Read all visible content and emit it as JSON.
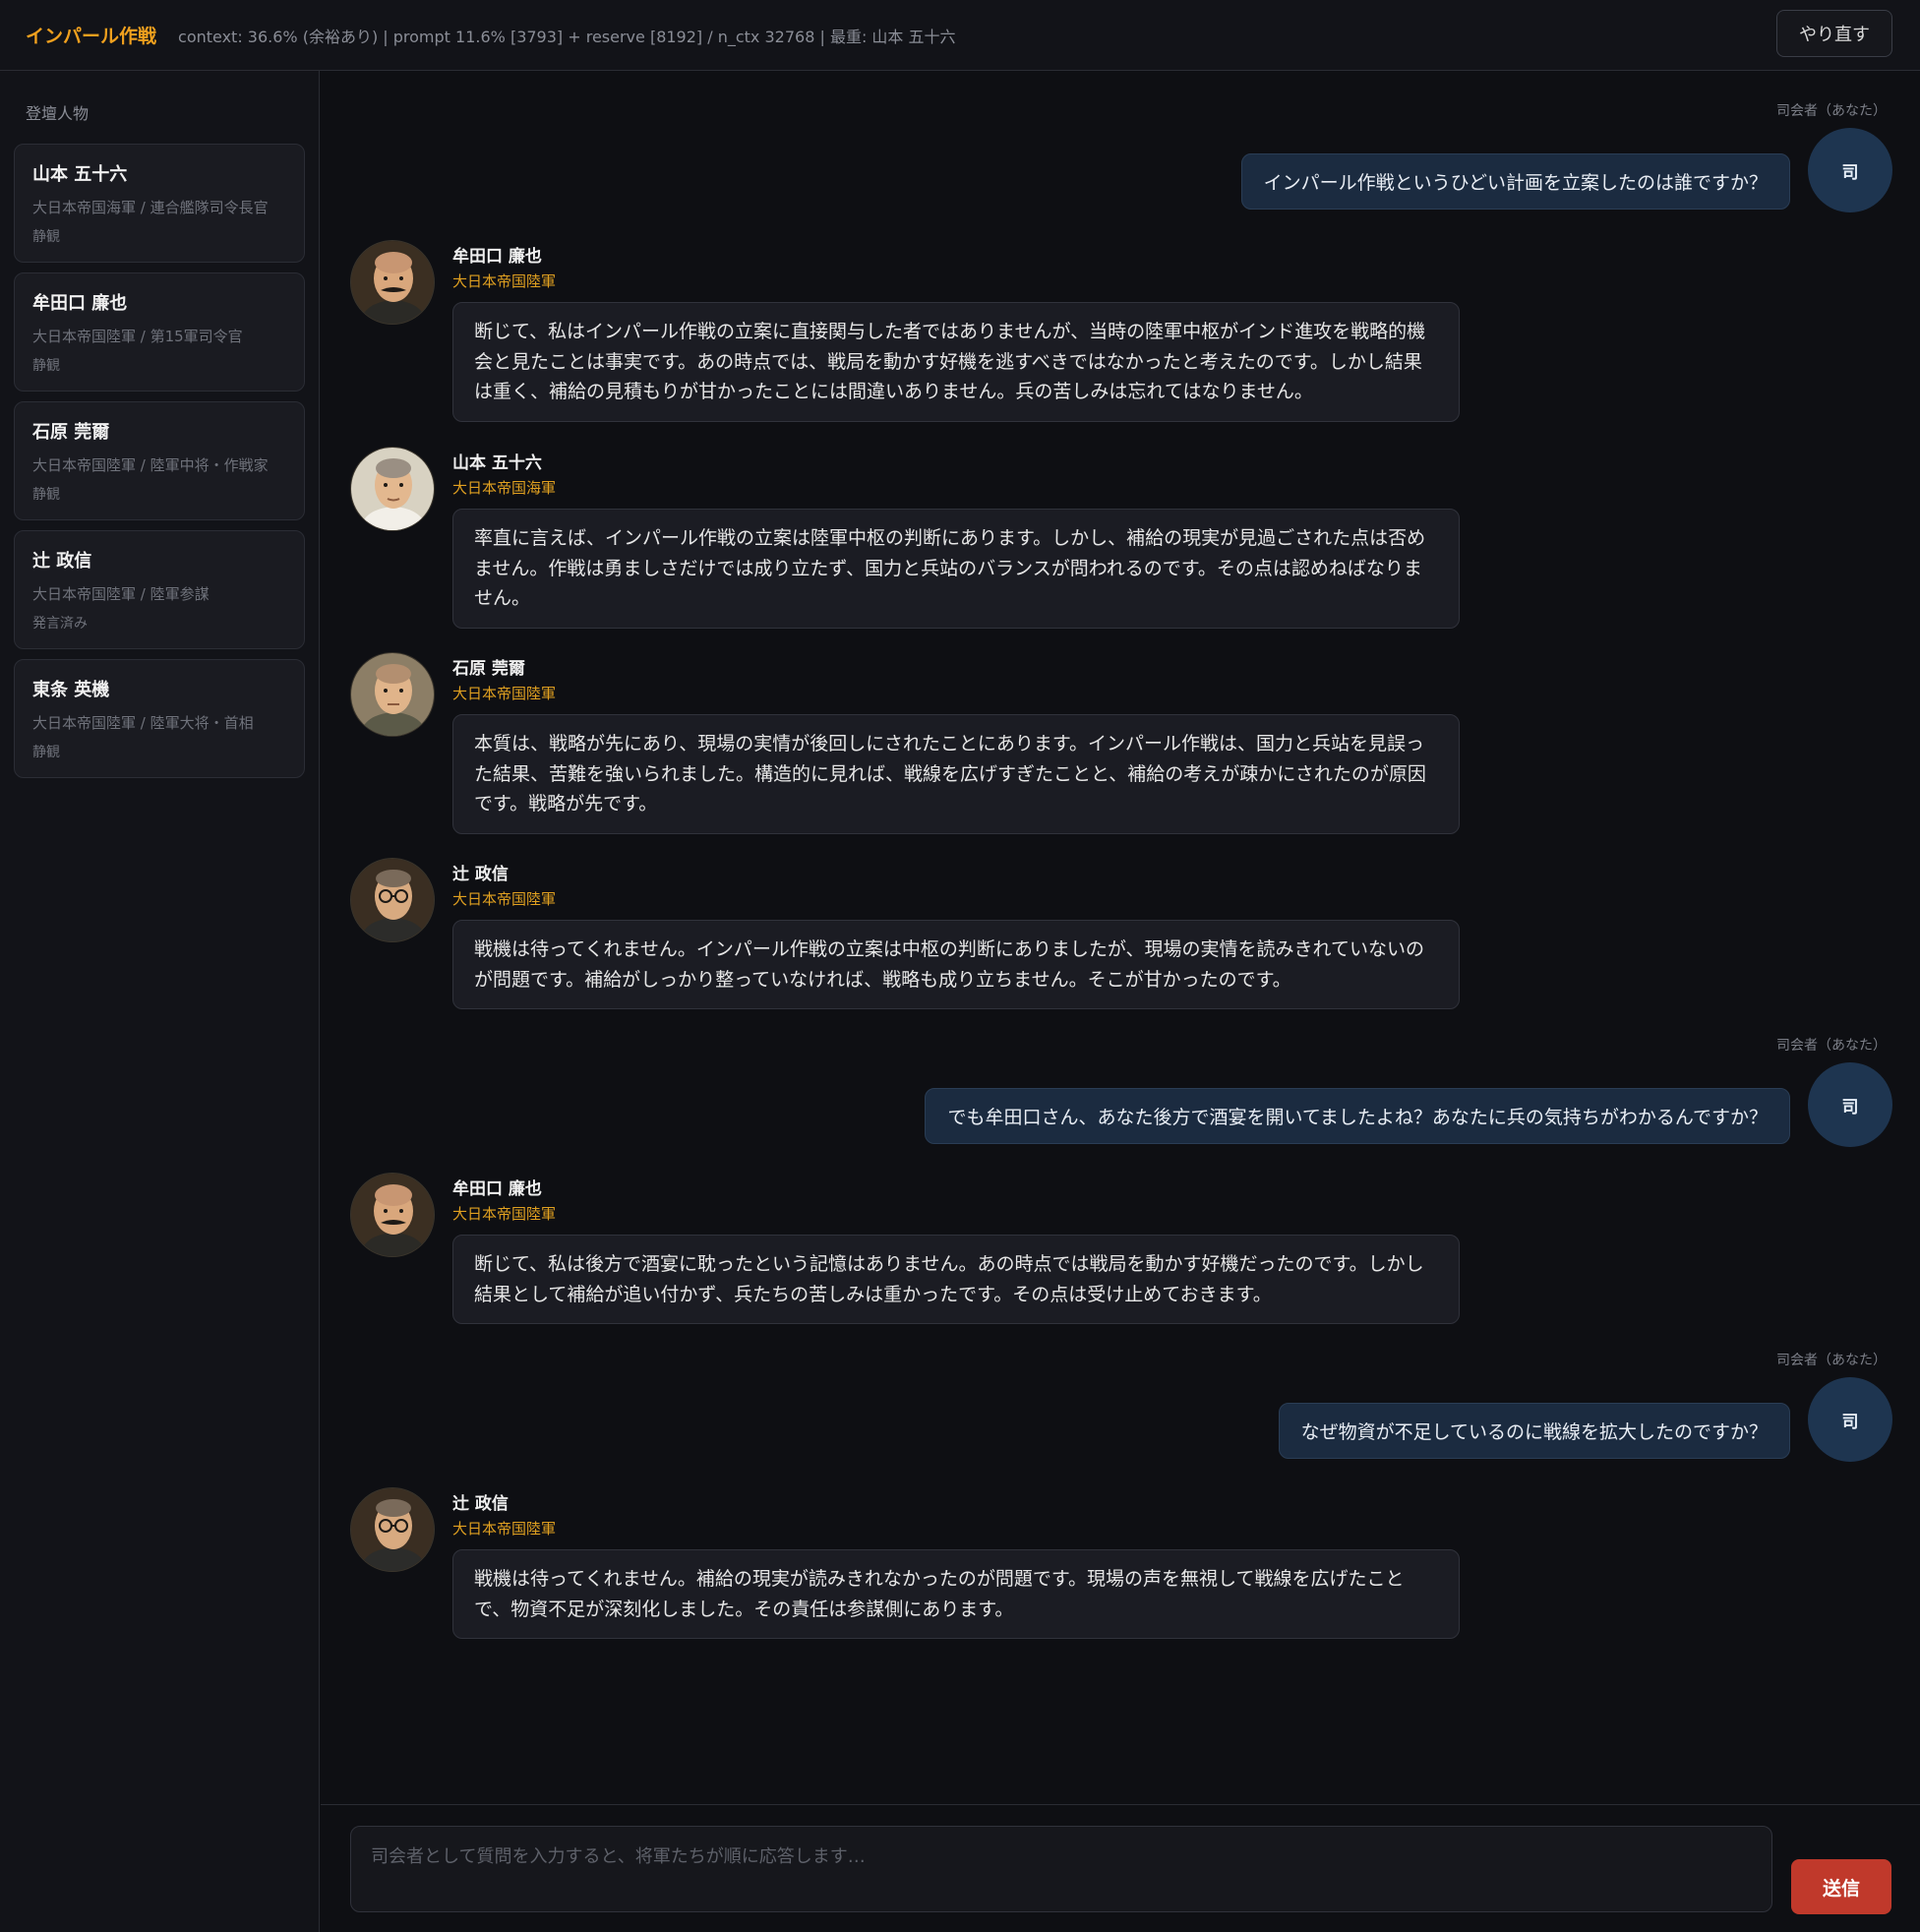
{
  "header": {
    "title": "インパール作戦",
    "context_info": "context: 36.6% (余裕あり) | prompt 11.6% [3793] + reserve [8192] / n_ctx 32768 | 最重: 山本 五十六",
    "redo_label": "やり直す"
  },
  "sidebar": {
    "title": "登壇人物",
    "characters": [
      {
        "name": "山本 五十六",
        "role": "大日本帝国海軍 / 連合艦隊司令長官",
        "status": "静観"
      },
      {
        "name": "牟田口 廉也",
        "role": "大日本帝国陸軍 / 第15軍司令官",
        "status": "静観"
      },
      {
        "name": "石原 莞爾",
        "role": "大日本帝国陸軍 / 陸軍中将・作戦家",
        "status": "静観"
      },
      {
        "name": "辻 政信",
        "role": "大日本帝国陸軍 / 陸軍参謀",
        "status": "発言済み"
      },
      {
        "name": "東条 英機",
        "role": "大日本帝国陸軍 / 陸軍大将・首相",
        "status": "静観"
      }
    ]
  },
  "messages": [
    {
      "role": "user",
      "label": "司会者（あなた）",
      "avatar": "司",
      "text": "インパール作戦というひどい計画を立案したのは誰ですか？"
    },
    {
      "role": "bot",
      "name": "牟田口 廉也",
      "affiliation": "大日本帝国陸軍",
      "avatar_icon": "general-mustache-portrait",
      "text": "断じて、私はインパール作戦の立案に直接関与した者ではありませんが、当時の陸軍中枢がインド進攻を戦略的機会と見たことは事実です。あの時点では、戦局を動かす好機を逃すべきではなかったと考えたのです。しかし結果は重く、補給の見積もりが甘かったことには間違いありません。兵の苦しみは忘れてはなりません。"
    },
    {
      "role": "bot",
      "name": "山本 五十六",
      "affiliation": "大日本帝国海軍",
      "avatar_icon": "admiral-portrait",
      "text": "率直に言えば、インパール作戦の立案は陸軍中枢の判断にあります。しかし、補給の現実が見過ごされた点は否めません。作戦は勇ましさだけでは成り立たず、国力と兵站のバランスが問われるのです。その点は認めねばなりません。"
    },
    {
      "role": "bot",
      "name": "石原 莞爾",
      "affiliation": "大日本帝国陸軍",
      "avatar_icon": "general-portrait",
      "text": "本質は、戦略が先にあり、現場の実情が後回しにされたことにあります。インパール作戦は、国力と兵站を見誤った結果、苦難を強いられました。構造的に見れば、戦線を広げすぎたことと、補給の考えが疎かにされたのが原因です。戦略が先です。"
    },
    {
      "role": "bot",
      "name": "辻 政信",
      "affiliation": "大日本帝国陸軍",
      "avatar_icon": "officer-glasses-portrait",
      "text": "戦機は待ってくれません。インパール作戦の立案は中枢の判断にありましたが、現場の実情を読みきれていないのが問題です。補給がしっかり整っていなければ、戦略も成り立ちません。そこが甘かったのです。"
    },
    {
      "role": "user",
      "label": "司会者（あなた）",
      "avatar": "司",
      "text": "でも牟田口さん、あなた後方で酒宴を開いてましたよね？あなたに兵の気持ちがわかるんですか？"
    },
    {
      "role": "bot",
      "name": "牟田口 廉也",
      "affiliation": "大日本帝国陸軍",
      "avatar_icon": "general-mustache-portrait",
      "text": "断じて、私は後方で酒宴に耽ったという記憶はありません。あの時点では戦局を動かす好機だったのです。しかし結果として補給が追い付かず、兵たちの苦しみは重かったです。その点は受け止めておきます。"
    },
    {
      "role": "user",
      "label": "司会者（あなた）",
      "avatar": "司",
      "text": "なぜ物資が不足しているのに戦線を拡大したのですか？"
    },
    {
      "role": "bot",
      "name": "辻 政信",
      "affiliation": "大日本帝国陸軍",
      "avatar_icon": "officer-glasses-portrait",
      "text": "戦機は待ってくれません。補給の現実が読みきれなかったのが問題です。現場の声を無視して戦線を広げたことで、物資不足が深刻化しました。その責任は参謀側にあります。"
    }
  ],
  "composer": {
    "placeholder": "司会者として質問を入力すると、将軍たちが順に応答します…",
    "send_label": "送信"
  },
  "colors": {
    "accent": "#f0a01e",
    "send_button": "#c0392b",
    "user_bubble": "#1b2b40",
    "background": "#0e0f13"
  }
}
